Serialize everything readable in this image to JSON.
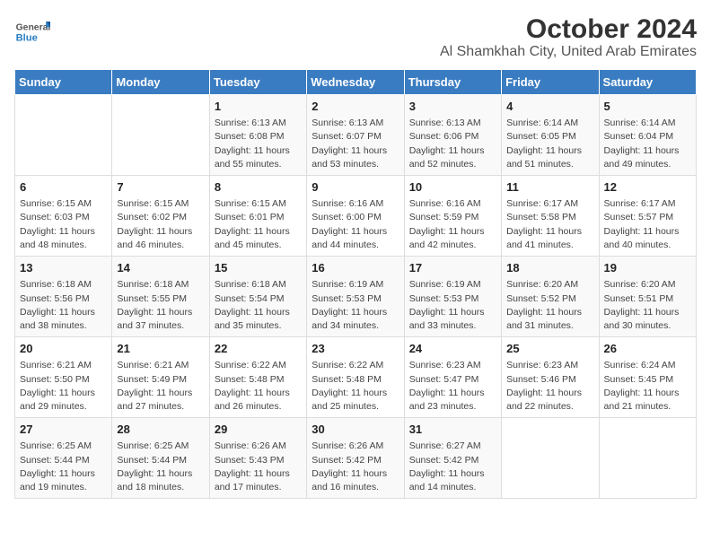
{
  "logo": {
    "line1": "General",
    "line2": "Blue"
  },
  "title": "October 2024",
  "subtitle": "Al Shamkhah City, United Arab Emirates",
  "days": [
    "Sunday",
    "Monday",
    "Tuesday",
    "Wednesday",
    "Thursday",
    "Friday",
    "Saturday"
  ],
  "weeks": [
    [
      {
        "day": "",
        "info": ""
      },
      {
        "day": "",
        "info": ""
      },
      {
        "day": "1",
        "info": "Sunrise: 6:13 AM\nSunset: 6:08 PM\nDaylight: 11 hours and 55 minutes."
      },
      {
        "day": "2",
        "info": "Sunrise: 6:13 AM\nSunset: 6:07 PM\nDaylight: 11 hours and 53 minutes."
      },
      {
        "day": "3",
        "info": "Sunrise: 6:13 AM\nSunset: 6:06 PM\nDaylight: 11 hours and 52 minutes."
      },
      {
        "day": "4",
        "info": "Sunrise: 6:14 AM\nSunset: 6:05 PM\nDaylight: 11 hours and 51 minutes."
      },
      {
        "day": "5",
        "info": "Sunrise: 6:14 AM\nSunset: 6:04 PM\nDaylight: 11 hours and 49 minutes."
      }
    ],
    [
      {
        "day": "6",
        "info": "Sunrise: 6:15 AM\nSunset: 6:03 PM\nDaylight: 11 hours and 48 minutes."
      },
      {
        "day": "7",
        "info": "Sunrise: 6:15 AM\nSunset: 6:02 PM\nDaylight: 11 hours and 46 minutes."
      },
      {
        "day": "8",
        "info": "Sunrise: 6:15 AM\nSunset: 6:01 PM\nDaylight: 11 hours and 45 minutes."
      },
      {
        "day": "9",
        "info": "Sunrise: 6:16 AM\nSunset: 6:00 PM\nDaylight: 11 hours and 44 minutes."
      },
      {
        "day": "10",
        "info": "Sunrise: 6:16 AM\nSunset: 5:59 PM\nDaylight: 11 hours and 42 minutes."
      },
      {
        "day": "11",
        "info": "Sunrise: 6:17 AM\nSunset: 5:58 PM\nDaylight: 11 hours and 41 minutes."
      },
      {
        "day": "12",
        "info": "Sunrise: 6:17 AM\nSunset: 5:57 PM\nDaylight: 11 hours and 40 minutes."
      }
    ],
    [
      {
        "day": "13",
        "info": "Sunrise: 6:18 AM\nSunset: 5:56 PM\nDaylight: 11 hours and 38 minutes."
      },
      {
        "day": "14",
        "info": "Sunrise: 6:18 AM\nSunset: 5:55 PM\nDaylight: 11 hours and 37 minutes."
      },
      {
        "day": "15",
        "info": "Sunrise: 6:18 AM\nSunset: 5:54 PM\nDaylight: 11 hours and 35 minutes."
      },
      {
        "day": "16",
        "info": "Sunrise: 6:19 AM\nSunset: 5:53 PM\nDaylight: 11 hours and 34 minutes."
      },
      {
        "day": "17",
        "info": "Sunrise: 6:19 AM\nSunset: 5:53 PM\nDaylight: 11 hours and 33 minutes."
      },
      {
        "day": "18",
        "info": "Sunrise: 6:20 AM\nSunset: 5:52 PM\nDaylight: 11 hours and 31 minutes."
      },
      {
        "day": "19",
        "info": "Sunrise: 6:20 AM\nSunset: 5:51 PM\nDaylight: 11 hours and 30 minutes."
      }
    ],
    [
      {
        "day": "20",
        "info": "Sunrise: 6:21 AM\nSunset: 5:50 PM\nDaylight: 11 hours and 29 minutes."
      },
      {
        "day": "21",
        "info": "Sunrise: 6:21 AM\nSunset: 5:49 PM\nDaylight: 11 hours and 27 minutes."
      },
      {
        "day": "22",
        "info": "Sunrise: 6:22 AM\nSunset: 5:48 PM\nDaylight: 11 hours and 26 minutes."
      },
      {
        "day": "23",
        "info": "Sunrise: 6:22 AM\nSunset: 5:48 PM\nDaylight: 11 hours and 25 minutes."
      },
      {
        "day": "24",
        "info": "Sunrise: 6:23 AM\nSunset: 5:47 PM\nDaylight: 11 hours and 23 minutes."
      },
      {
        "day": "25",
        "info": "Sunrise: 6:23 AM\nSunset: 5:46 PM\nDaylight: 11 hours and 22 minutes."
      },
      {
        "day": "26",
        "info": "Sunrise: 6:24 AM\nSunset: 5:45 PM\nDaylight: 11 hours and 21 minutes."
      }
    ],
    [
      {
        "day": "27",
        "info": "Sunrise: 6:25 AM\nSunset: 5:44 PM\nDaylight: 11 hours and 19 minutes."
      },
      {
        "day": "28",
        "info": "Sunrise: 6:25 AM\nSunset: 5:44 PM\nDaylight: 11 hours and 18 minutes."
      },
      {
        "day": "29",
        "info": "Sunrise: 6:26 AM\nSunset: 5:43 PM\nDaylight: 11 hours and 17 minutes."
      },
      {
        "day": "30",
        "info": "Sunrise: 6:26 AM\nSunset: 5:42 PM\nDaylight: 11 hours and 16 minutes."
      },
      {
        "day": "31",
        "info": "Sunrise: 6:27 AM\nSunset: 5:42 PM\nDaylight: 11 hours and 14 minutes."
      },
      {
        "day": "",
        "info": ""
      },
      {
        "day": "",
        "info": ""
      }
    ]
  ]
}
